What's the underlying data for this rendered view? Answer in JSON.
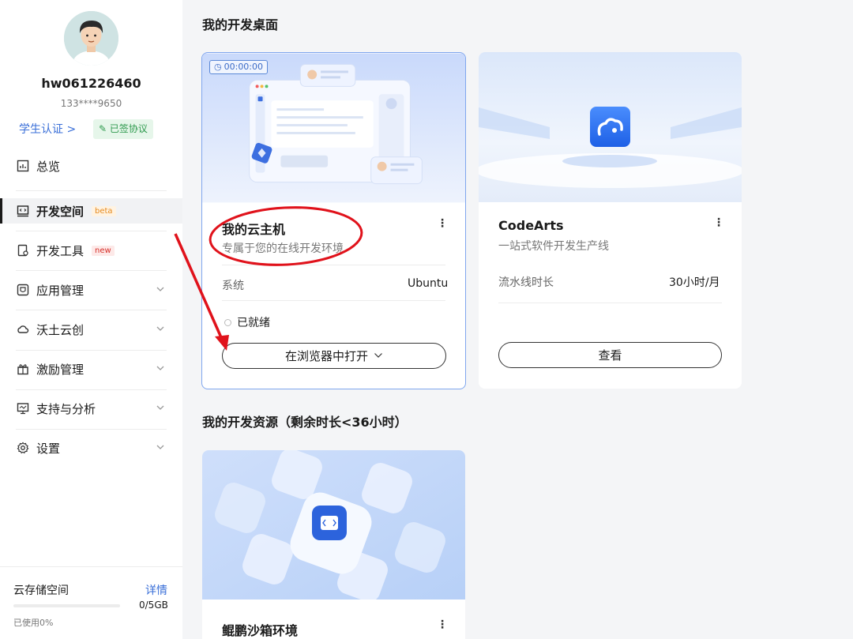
{
  "profile": {
    "username": "hw061226460",
    "phone": "133****9650",
    "student_link": "学生认证 >",
    "signed_badge": "已签协议"
  },
  "nav": {
    "overview": "总览",
    "devspace": "开发空间",
    "devspace_tag": "beta",
    "devtools": "开发工具",
    "devtools_tag": "new",
    "app_manage": "应用管理",
    "wotu": "沃土云创",
    "incentive": "激励管理",
    "support": "支持与分析",
    "settings": "设置"
  },
  "storage": {
    "title": "云存储空间",
    "detail": "详情",
    "quota": "0/5GB",
    "used": "已使用0%",
    "used_fraction": 0.0
  },
  "main": {
    "desktop_title": "我的开发桌面",
    "resources_title": "我的开发资源（剩余时长<36小时）"
  },
  "cards": {
    "cloud": {
      "timer": "00:00:00",
      "title": "我的云主机",
      "subtitle": "专属于您的在线开发环境",
      "row_label": "系统",
      "row_value": "Ubuntu",
      "status": "已就绪",
      "button": "在浏览器中打开"
    },
    "codearts": {
      "title": "CodeArts",
      "subtitle": "一站式软件开发生产线",
      "row_label": "流水线时长",
      "row_value": "30小时/月",
      "button": "查看"
    },
    "sandbox": {
      "title": "鲲鹏沙箱环境"
    }
  },
  "colors": {
    "accent": "#3a6fd8",
    "annotation": "#e0121b",
    "success": "#2f9a4e"
  }
}
